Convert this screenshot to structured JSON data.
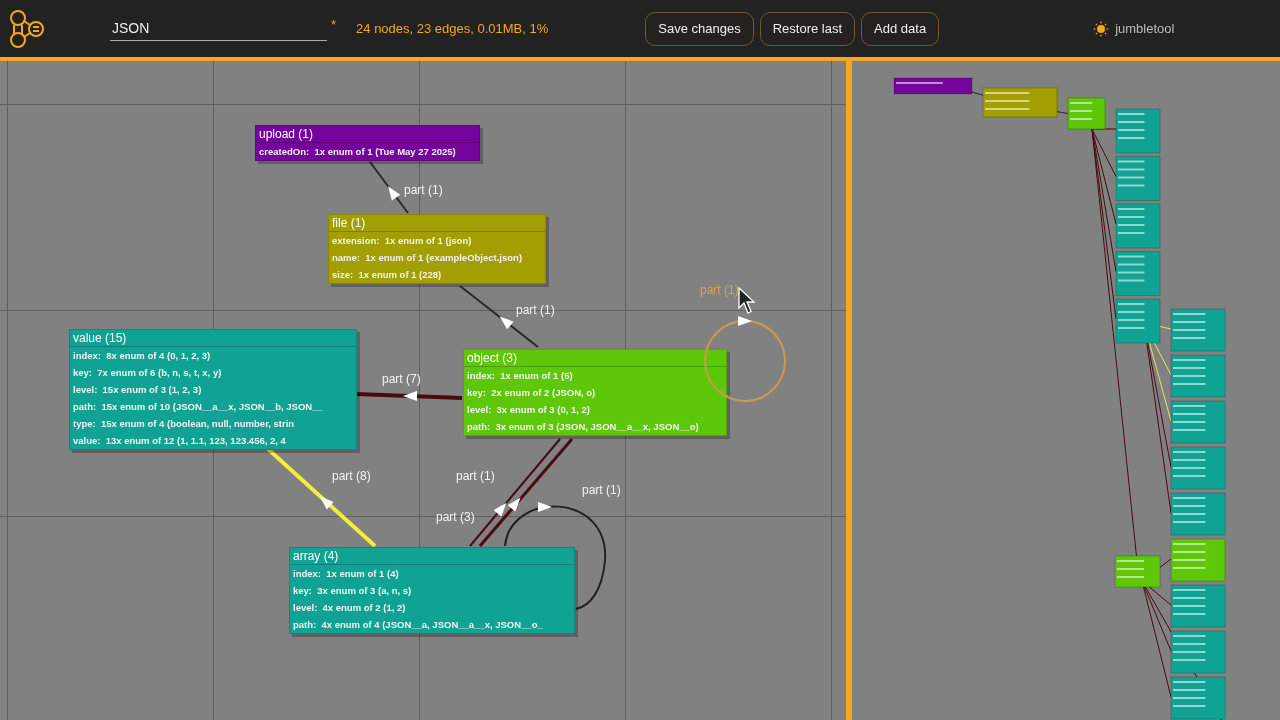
{
  "header": {
    "filename": "JSON",
    "unsaved_mark": "*",
    "stats": "24 nodes, 23 edges, 0.01MB, 1%",
    "buttons": [
      "Save changes",
      "Restore last",
      "Add data"
    ],
    "brand": "jumbletool"
  },
  "graph": {
    "nodes": [
      {
        "title": "upload (1)",
        "color": "#74049c",
        "fields": [
          "createdOn:  1x enum of 1 (Tue May 27 2025)"
        ]
      },
      {
        "title": "file (1)",
        "color": "#a39e02",
        "fields": [
          "extension:  1x enum of 1 (json)",
          "name:  1x enum of 1 (exampleObject.json)",
          "size:  1x enum of 1 (228)"
        ]
      },
      {
        "title": "value (15)",
        "color": "#10a394",
        "fields": [
          "index:  8x enum of 4 (0, 1, 2, 3)",
          "key:  7x enum of 6 (b, n, s, t, x, y)",
          "level:  15x enum of 3 (1, 2, 3)",
          "path:  15x enum of 10 (JSON__a__x, JSON__b, JSON__",
          "type:  15x enum of 4 (boolean, null, number, strin",
          "value:  13x enum of 12 (1, 1.1, 123, 123.456, 2, 4"
        ]
      },
      {
        "title": "object (3)",
        "color": "#5ec70a",
        "fields": [
          "index:  1x enum of 1 (5)",
          "key:  2x enum of 2 (JSON, o)",
          "level:  3x enum of 3 (0, 1, 2)",
          "path:  3x enum of 3 (JSON, JSON__a__x, JSON__o)"
        ]
      },
      {
        "title": "array (4)",
        "color": "#10a394",
        "fields": [
          "index:  1x enum of 1 (4)",
          "key:  3x enum of 3 (a, n, s)",
          "level:  4x enum of 2 (1, 2)",
          "path:  4x enum of 4 (JSON__a, JSON__a__x, JSON__o_"
        ]
      }
    ],
    "edges": [
      {
        "label": "part (1)",
        "color": "#2a2a2a",
        "highlighted": false
      },
      {
        "label": "part (1)",
        "color": "#2a2a2a",
        "highlighted": false
      },
      {
        "label": "part (7)",
        "color": "#4a0a12",
        "highlighted": false
      },
      {
        "label": "part (8)",
        "color": "#f2ee3a",
        "highlighted": false
      },
      {
        "label": "part (1)",
        "color": "#4a0a12",
        "highlighted": false
      },
      {
        "label": "part (3)",
        "color": "#4a0a12",
        "highlighted": false
      },
      {
        "label": "part (1)",
        "color": "#222222",
        "highlighted": false
      },
      {
        "label": "part (1)",
        "color": "#d09a48",
        "highlighted": true
      }
    ]
  }
}
